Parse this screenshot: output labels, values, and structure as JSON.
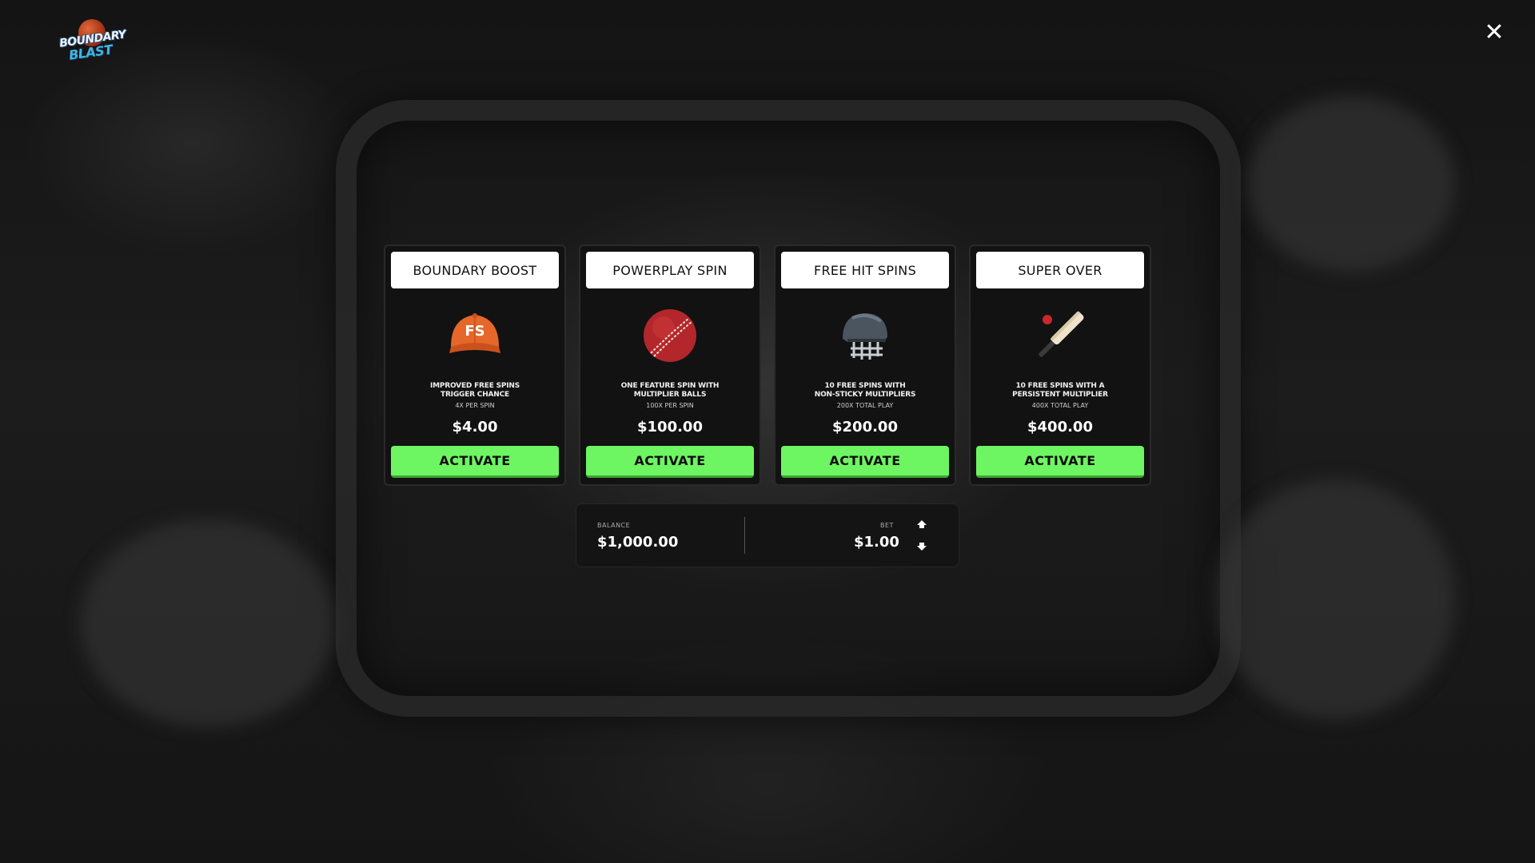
{
  "logo": {
    "line1": "BOUNDARY",
    "line2": "BLAST"
  },
  "close_label": "✕",
  "cards": [
    {
      "title": "BOUNDARY BOOST",
      "icon": "orange-cap-fs-icon",
      "icon_text": "FS",
      "desc_line1": "IMPROVED FREE SPINS",
      "desc_line2": "TRIGGER CHANCE",
      "sub": "4X PER SPIN",
      "price": "$4.00",
      "button": "ACTIVATE"
    },
    {
      "title": "POWERPLAY SPIN",
      "icon": "cricket-ball-icon",
      "desc_line1": "ONE FEATURE SPIN WITH",
      "desc_line2": "MULTIPLIER BALLS",
      "sub": "100X PER SPIN",
      "price": "$100.00",
      "button": "ACTIVATE"
    },
    {
      "title": "FREE HIT SPINS",
      "icon": "cricket-helmet-icon",
      "desc_line1": "10 FREE SPINS WITH",
      "desc_line2": "NON-STICKY MULTIPLIERS",
      "sub": "200X TOTAL PLAY",
      "price": "$200.00",
      "button": "ACTIVATE"
    },
    {
      "title": "SUPER OVER",
      "icon": "cricket-bat-icon",
      "desc_line1": "10 FREE SPINS WITH A",
      "desc_line2": "PERSISTENT MULTIPLIER",
      "sub": "400X TOTAL PLAY",
      "price": "$400.00",
      "button": "ACTIVATE"
    }
  ],
  "balance": {
    "label": "BALANCE",
    "value": "$1,000.00"
  },
  "bet": {
    "label": "BET",
    "value": "$1.00"
  },
  "colors": {
    "activate_green": "#6ef562",
    "cap_orange": "#e5682a",
    "ball_red": "#b3262b",
    "background": "#101010"
  }
}
